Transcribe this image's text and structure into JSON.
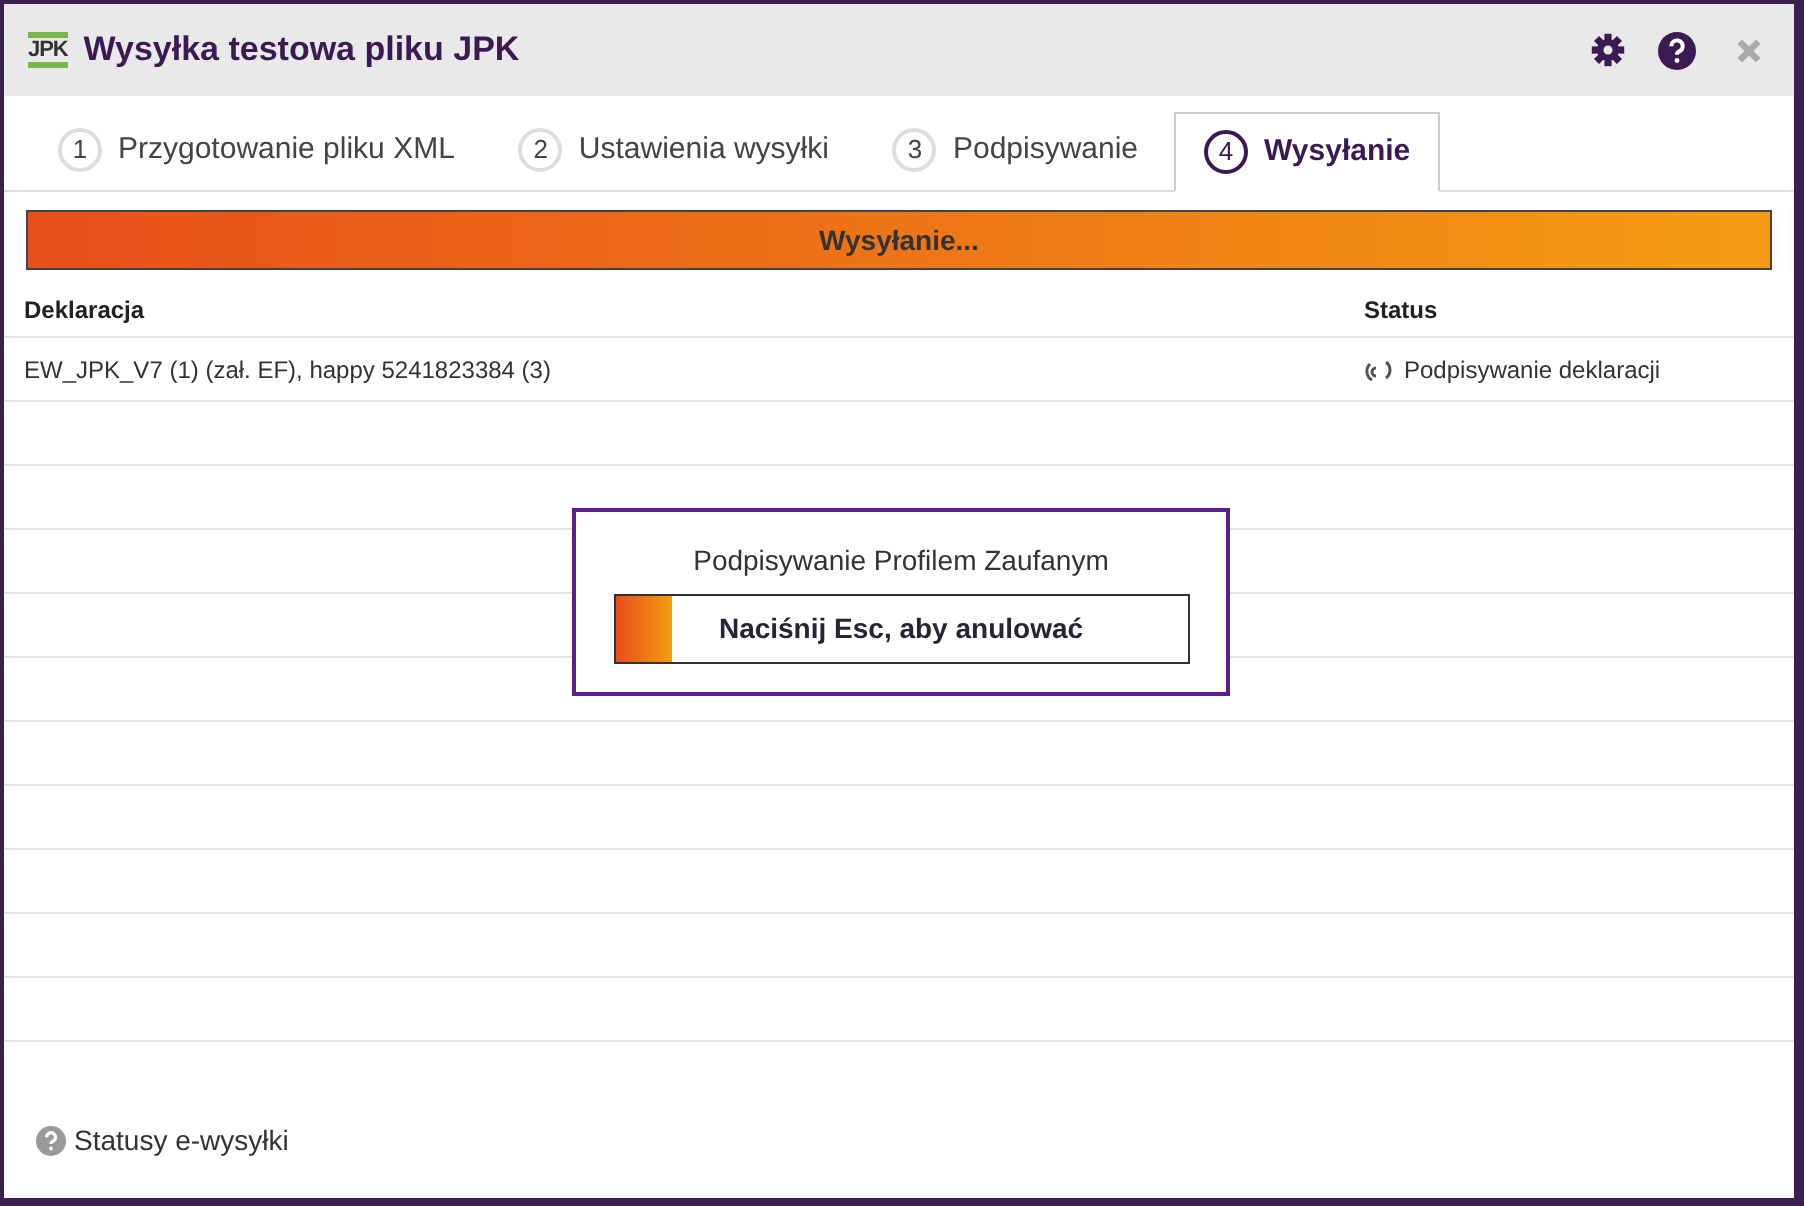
{
  "window": {
    "title": "Wysyłka testowa pliku JPK",
    "logo": "JPK"
  },
  "tabs": [
    {
      "number": "1",
      "label": "Przygotowanie pliku XML",
      "selected": false
    },
    {
      "number": "2",
      "label": "Ustawienia wysyłki",
      "selected": false
    },
    {
      "number": "3",
      "label": "Podpisywanie",
      "selected": false
    },
    {
      "number": "4",
      "label": "Wysyłanie",
      "selected": true
    }
  ],
  "progress": {
    "label": "Wysyłanie...",
    "level": 1
  },
  "table": {
    "columns": [
      "Deklaracja",
      "Status"
    ],
    "rows": [
      {
        "declaration": "EW_JPK_V7 (1) (zał. EF), happy 5241823384 (3)",
        "status": "Podpisywanie deklaracji"
      }
    ]
  },
  "dialog": {
    "title": "Podpisywanie Profilem Zaufanym",
    "message": "Naciśnij Esc, aby anulować",
    "level": 0.1
  },
  "footer_link": "Statusy e-wysyłki"
}
